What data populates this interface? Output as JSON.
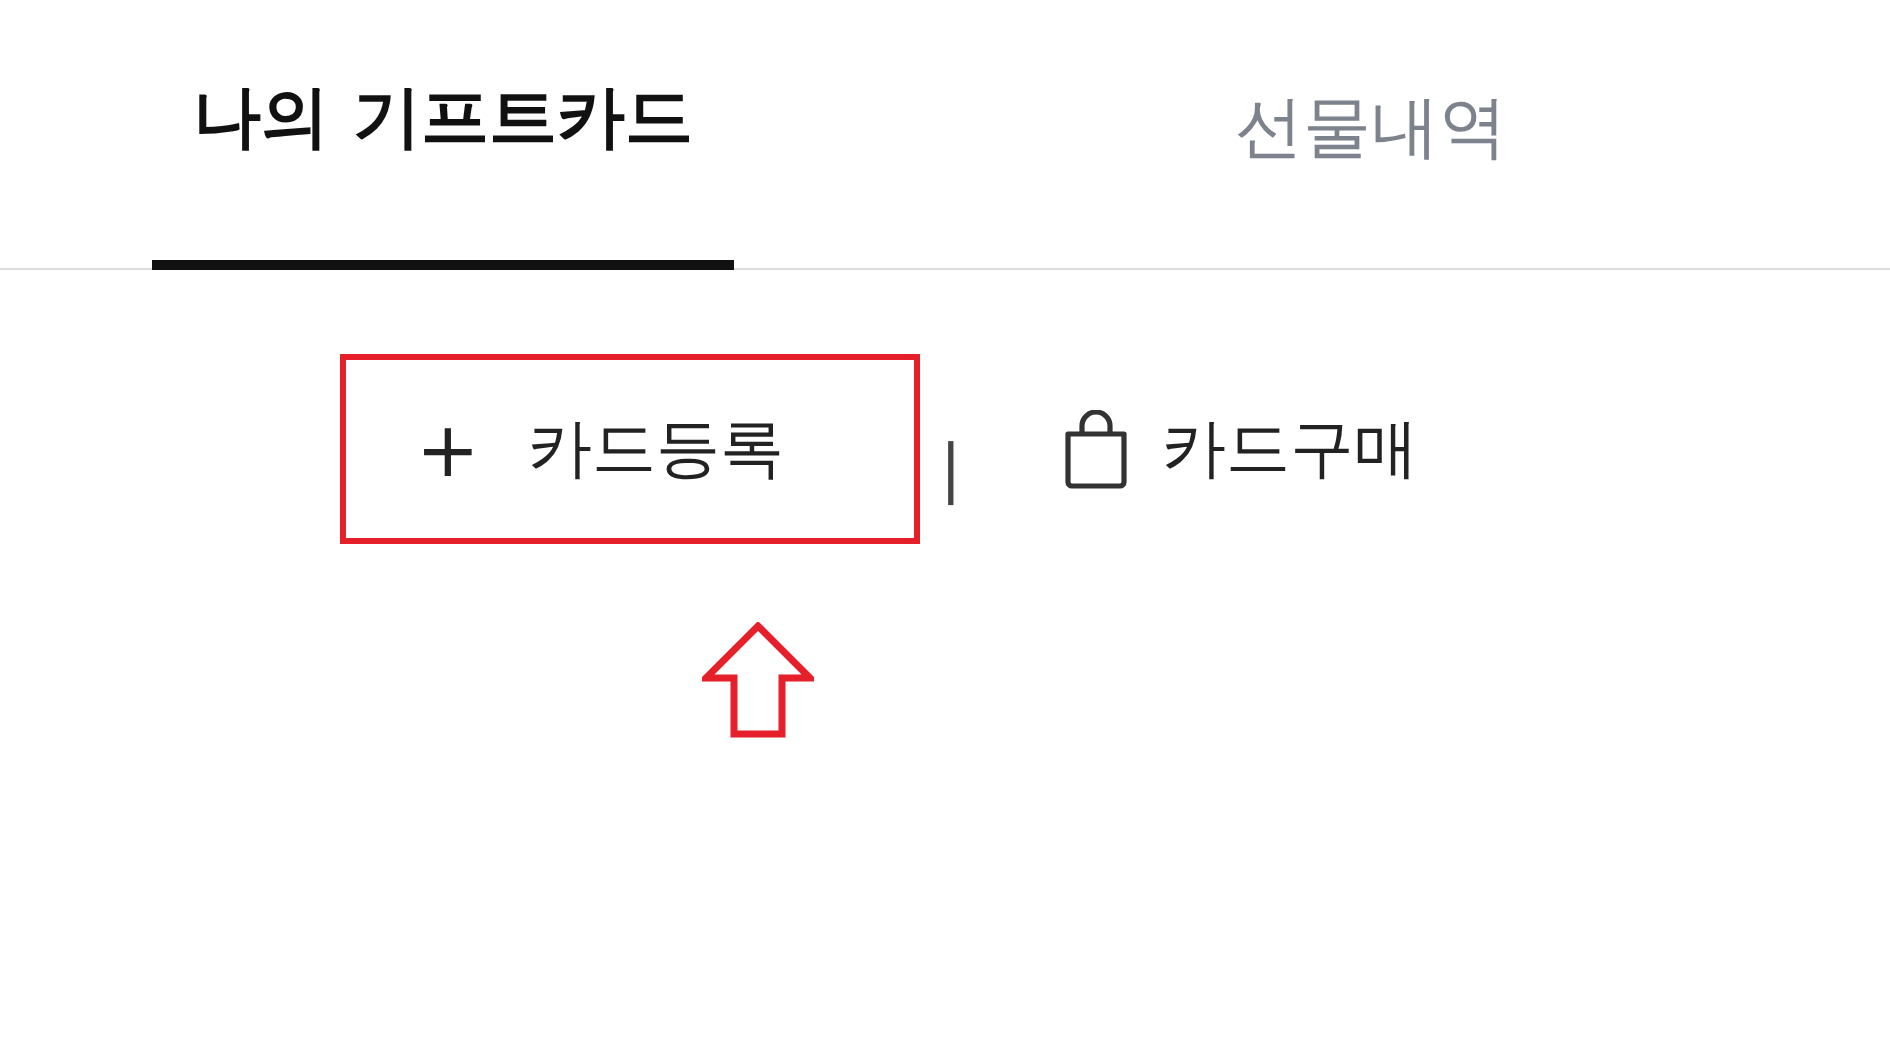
{
  "tabs": [
    {
      "label": "나의 기프트카드",
      "selected": true
    },
    {
      "label": "선물내역",
      "selected": false
    }
  ],
  "actions": [
    {
      "kind": "register",
      "icon": "+",
      "label": "카드등록",
      "highlighted": true
    },
    {
      "kind": "buy",
      "label": "카드구매",
      "highlighted": false
    }
  ],
  "separator": "|",
  "pointer_arrow": true
}
